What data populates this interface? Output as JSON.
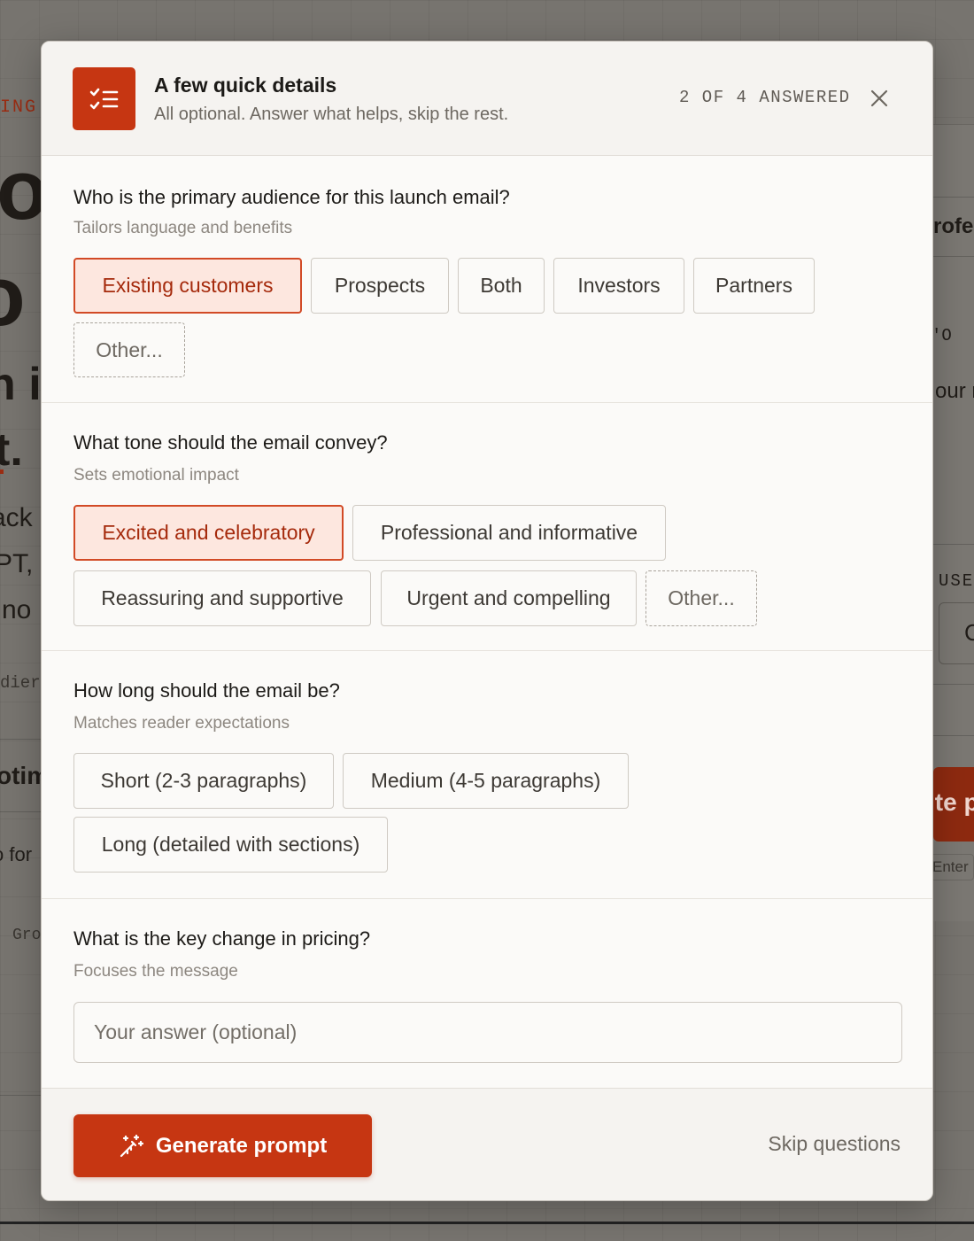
{
  "background": {
    "left_fragments": [
      "ING",
      "ot",
      "o",
      "n ir",
      "t.",
      "ack",
      "PT, C",
      "no",
      "dier",
      "otim",
      "o for",
      "Gro"
    ],
    "right_fragments": [
      "rofe",
      "'O",
      "our r",
      "USE",
      "C",
      "ite p",
      "Enter"
    ]
  },
  "header": {
    "icon": "checklist-icon",
    "title": "A few quick details",
    "subtitle": "All optional. Answer what helps, skip the rest.",
    "progress": "2 OF 4 ANSWERED",
    "close_icon": "close-icon"
  },
  "questions": [
    {
      "title": "Who is the primary audience for this launch email?",
      "hint": "Tailors language and benefits",
      "options": [
        "Existing customers",
        "Prospects",
        "Both",
        "Investors",
        "Partners",
        "Other..."
      ],
      "selected": "Existing customers"
    },
    {
      "title": "What tone should the email convey?",
      "hint": "Sets emotional impact",
      "options": [
        "Excited and celebratory",
        "Professional and informative",
        "Reassuring and supportive",
        "Urgent and compelling",
        "Other..."
      ],
      "selected": "Excited and celebratory"
    },
    {
      "title": "How long should the email be?",
      "hint": "Matches reader expectations",
      "options": [
        "Short (2-3 paragraphs)",
        "Medium (4-5 paragraphs)",
        "Long (detailed with sections)"
      ],
      "selected": null
    },
    {
      "title": "What is the key change in pricing?",
      "hint": "Focuses the message",
      "input_placeholder": "Your answer (optional)",
      "input_value": ""
    }
  ],
  "footer": {
    "generate_label": "Generate prompt",
    "generate_icon": "magic-wand-icon",
    "skip_label": "Skip questions"
  },
  "colors": {
    "accent": "#c63612",
    "selected_bg": "#fde7df",
    "selected_text": "#a52a0c"
  }
}
